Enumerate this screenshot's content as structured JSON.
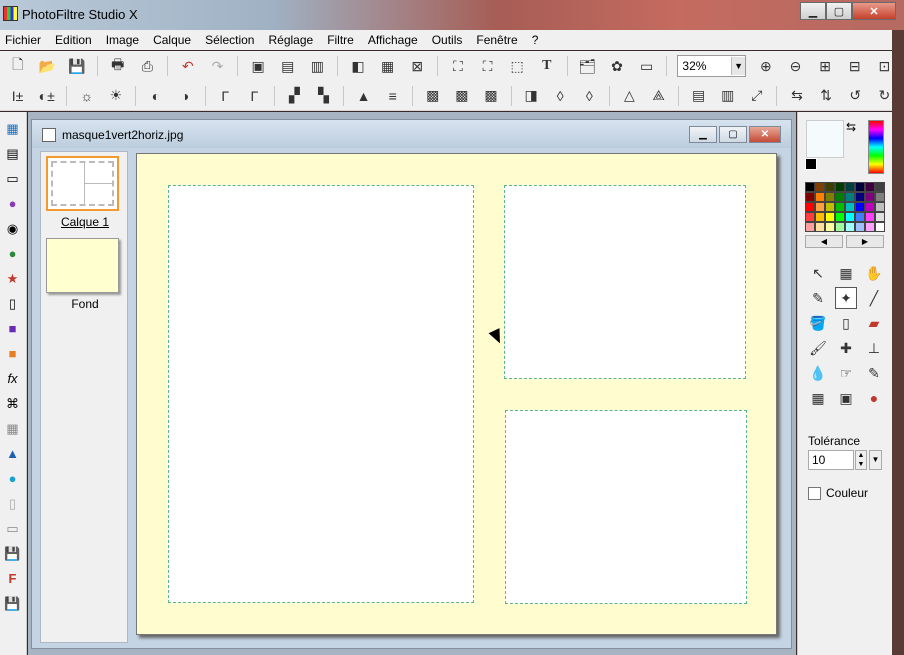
{
  "app": {
    "title": "PhotoFiltre Studio X"
  },
  "window_controls": {
    "minimize": "▁",
    "maximize": "▢",
    "close": "✕"
  },
  "menu": [
    "Fichier",
    "Edition",
    "Image",
    "Calque",
    "Sélection",
    "Réglage",
    "Filtre",
    "Affichage",
    "Outils",
    "Fenêtre",
    "?"
  ],
  "toolbar": {
    "zoom_value": "32%"
  },
  "document": {
    "name": "masque1vert2horiz.jpg"
  },
  "layers": [
    {
      "label": "Calque 1"
    },
    {
      "label": "Fond"
    }
  ],
  "colors": {
    "canvas_bg": "#fffdcf",
    "panel_border": "#5bb58a",
    "foreground": "#f5fbfc",
    "background": "#000000",
    "active_layer_border": "#f29a2e"
  },
  "palette": [
    "#000000",
    "#7f3f00",
    "#3f3f00",
    "#003f00",
    "#003f3f",
    "#00003f",
    "#3f003f",
    "#3f3f3f",
    "#7f0000",
    "#ff7f00",
    "#7f7f00",
    "#007f00",
    "#007f7f",
    "#00007f",
    "#7f007f",
    "#7f7f7f",
    "#ff0000",
    "#ff9f3f",
    "#bfbf00",
    "#00bf00",
    "#00bfbf",
    "#0000ff",
    "#bf00bf",
    "#bfbfbf",
    "#ff3f3f",
    "#ffbf00",
    "#ffff00",
    "#00ff00",
    "#00ffff",
    "#3f7fff",
    "#ff3fff",
    "#dfdfdf",
    "#ff9f9f",
    "#ffdf9f",
    "#ffff9f",
    "#9fff9f",
    "#9fffff",
    "#9fbfff",
    "#ff9fff",
    "#ffffff"
  ],
  "tolerance": {
    "label": "Tolérance",
    "value": "10"
  },
  "couleur": {
    "label": "Couleur"
  }
}
